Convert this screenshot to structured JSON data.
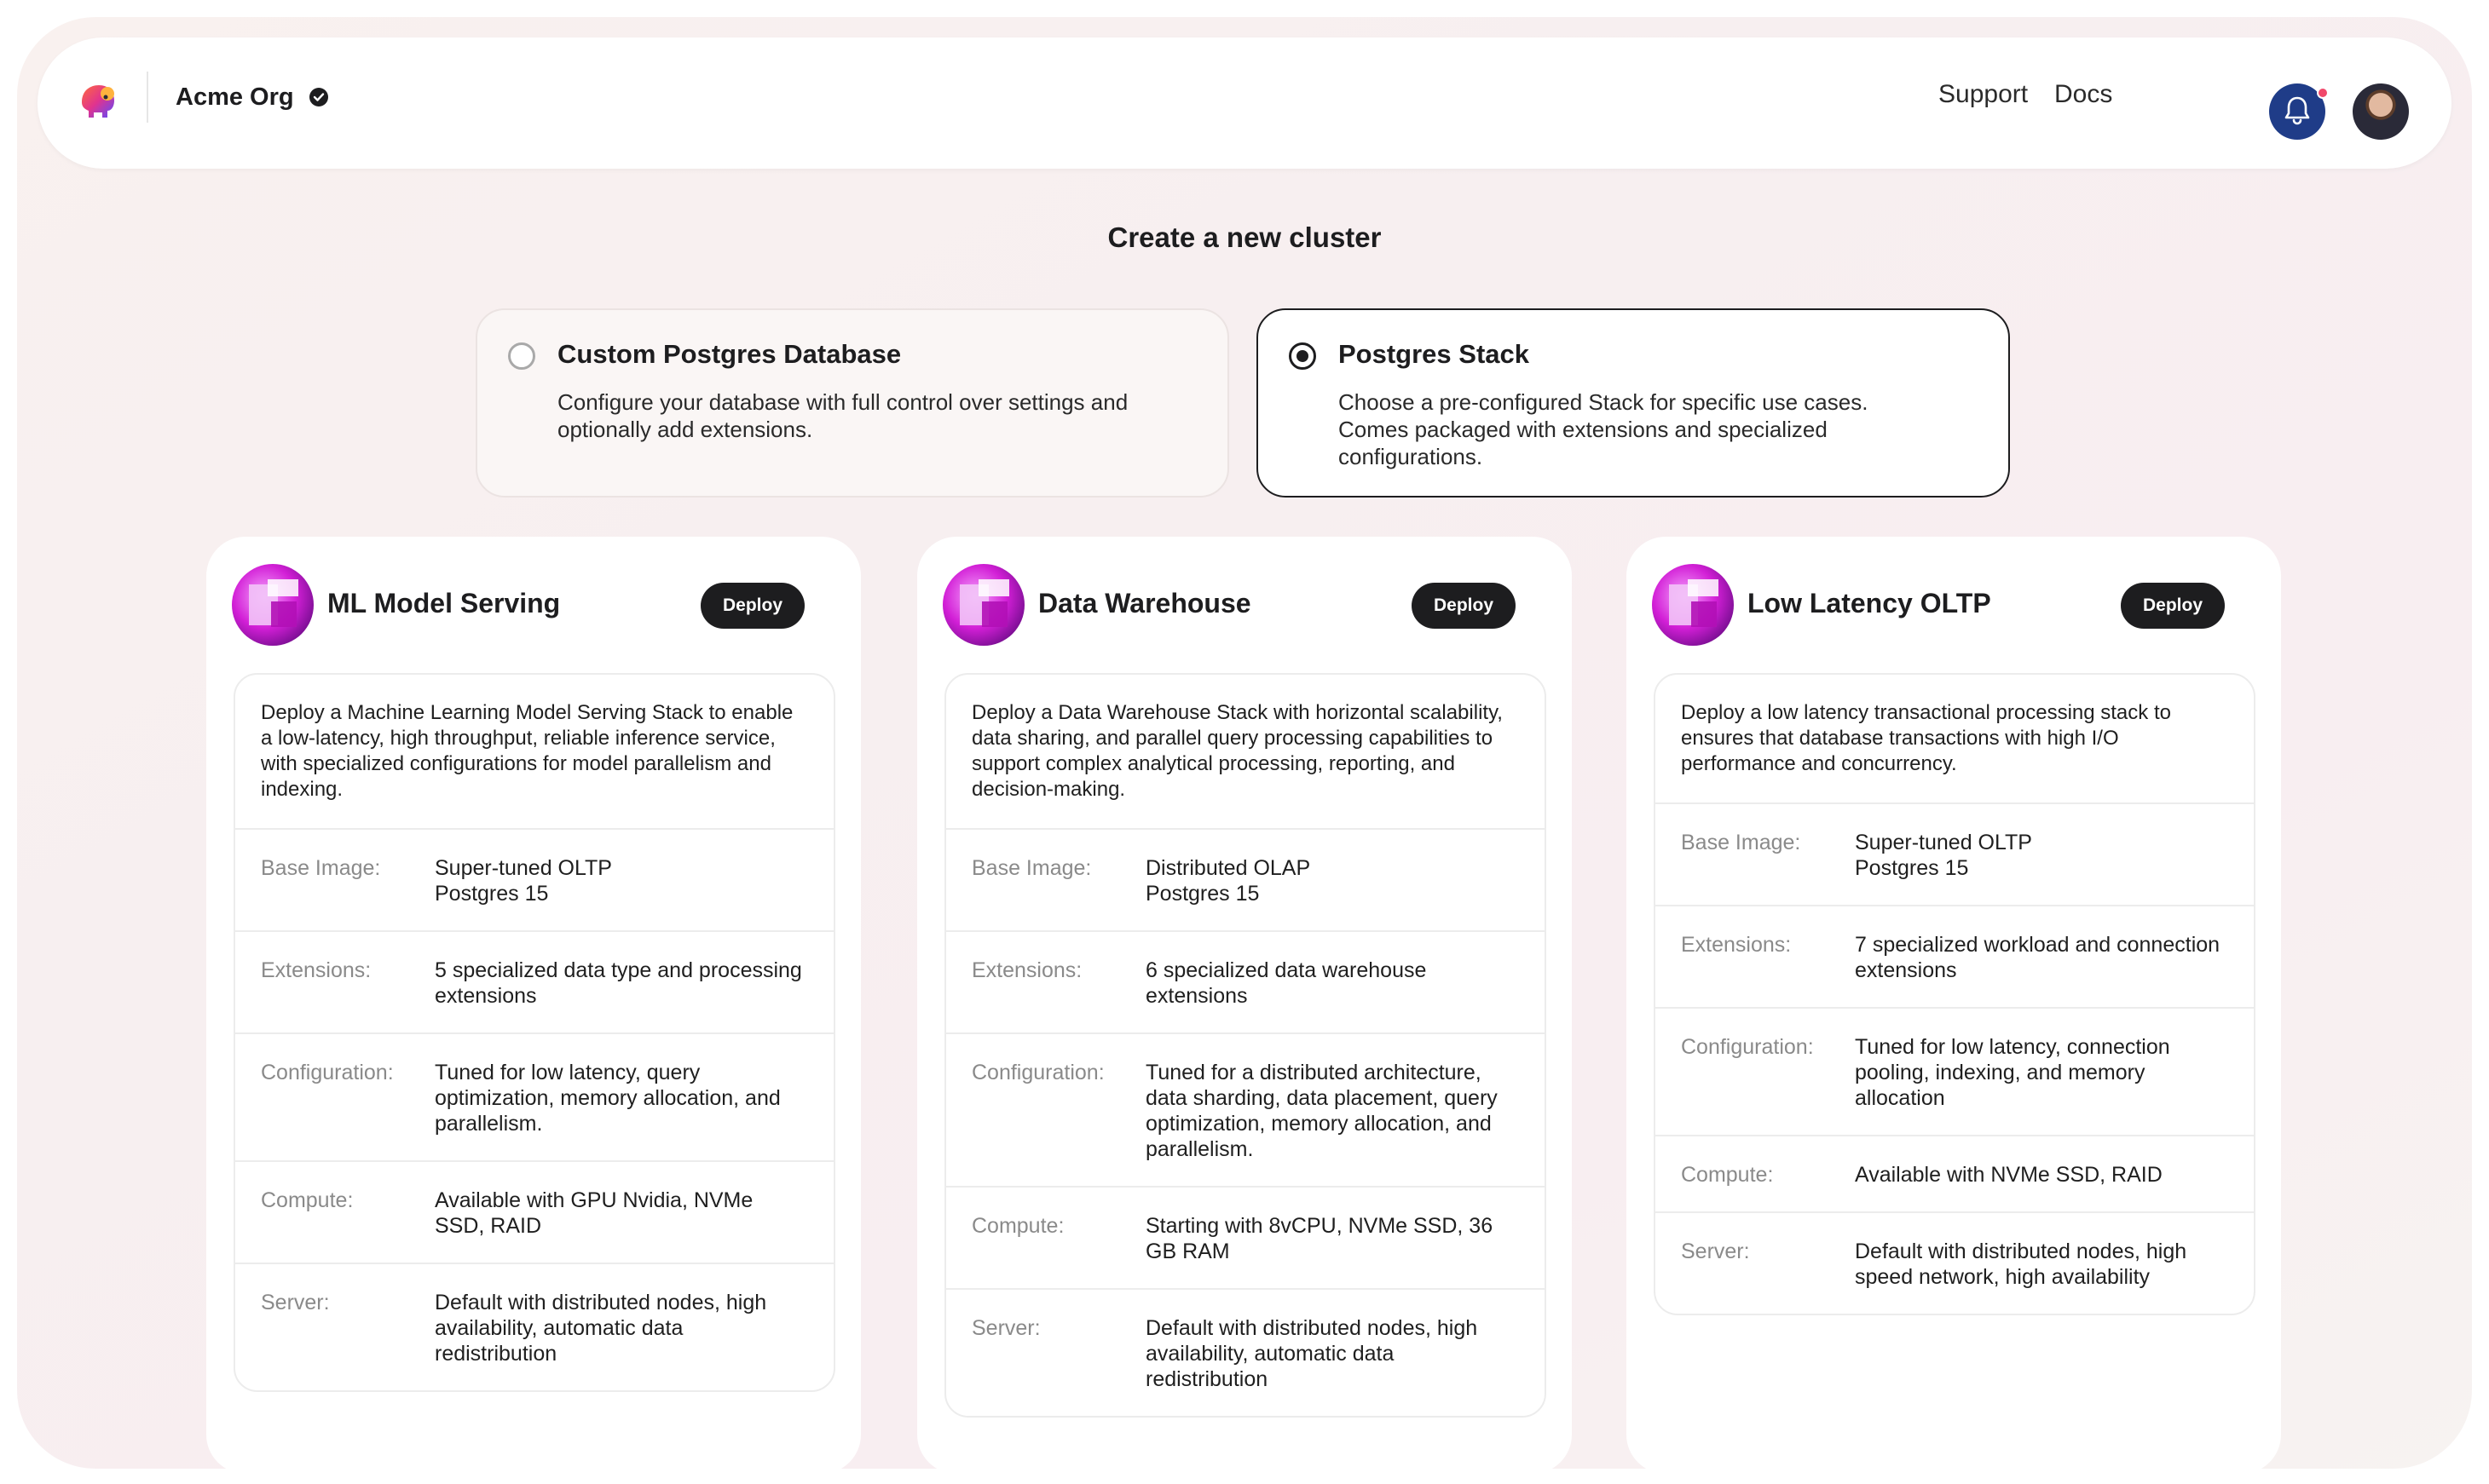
{
  "header": {
    "org_name": "Acme Org",
    "links": [
      "Support",
      "Docs"
    ],
    "icons": {
      "logo": "elephant-logo-icon",
      "verified": "check-circle-icon",
      "notifications": "bell-icon",
      "notification_dot_color": "#f0486a"
    }
  },
  "page_title": "Create a new cluster",
  "options": [
    {
      "title": "Custom Postgres Database",
      "description": "Configure your database with full control over settings and optionally add extensions.",
      "selected": false
    },
    {
      "title": "Postgres Stack",
      "description": "Choose a pre-configured Stack for specific use cases. Comes packaged with extensions and specialized configurations.",
      "selected": true
    }
  ],
  "deploy_label": "Deploy",
  "labels": {
    "base_image": "Base Image:",
    "extensions": "Extensions:",
    "configuration": "Configuration:",
    "compute": "Compute:",
    "server": "Server:"
  },
  "stacks": [
    {
      "title": "ML Model Serving",
      "description": "Deploy a Machine Learning Model Serving Stack to enable a low-latency, high throughput, reliable inference service, with specialized configurations for model parallelism and indexing.",
      "base_image": "Super-tuned OLTP\nPostgres 15",
      "extensions": "5 specialized data type and processing extensions",
      "configuration": "Tuned for low latency, query optimization, memory allocation, and parallelism.",
      "compute": "Available with GPU Nvidia, NVMe SSD, RAID",
      "server": "Default with distributed nodes, high availability, automatic data redistribution"
    },
    {
      "title": "Data Warehouse",
      "description": "Deploy a Data Warehouse Stack with horizontal scalability, data sharing, and parallel query processing capabilities to support complex analytical processing, reporting, and decision-making.",
      "base_image": "Distributed OLAP\nPostgres 15",
      "extensions": "6 specialized data warehouse extensions",
      "configuration": "Tuned for a distributed architecture, data sharding, data placement, query optimization, memory allocation, and parallelism.",
      "compute": "Starting with 8vCPU, NVMe SSD, 36 GB RAM",
      "server": "Default with distributed nodes, high availability, automatic data redistribution"
    },
    {
      "title": "Low Latency OLTP",
      "description": "Deploy a low latency transactional processing stack to ensures that database transactions with high I/O performance and concurrency.",
      "base_image": "Super-tuned OLTP\nPostgres 15",
      "extensions": "7 specialized workload and connection extensions",
      "configuration": "Tuned for low latency, connection pooling, indexing, and memory allocation",
      "compute": "Available with NVMe SSD, RAID",
      "server": "Default with distributed nodes, high speed network, high availability"
    }
  ]
}
